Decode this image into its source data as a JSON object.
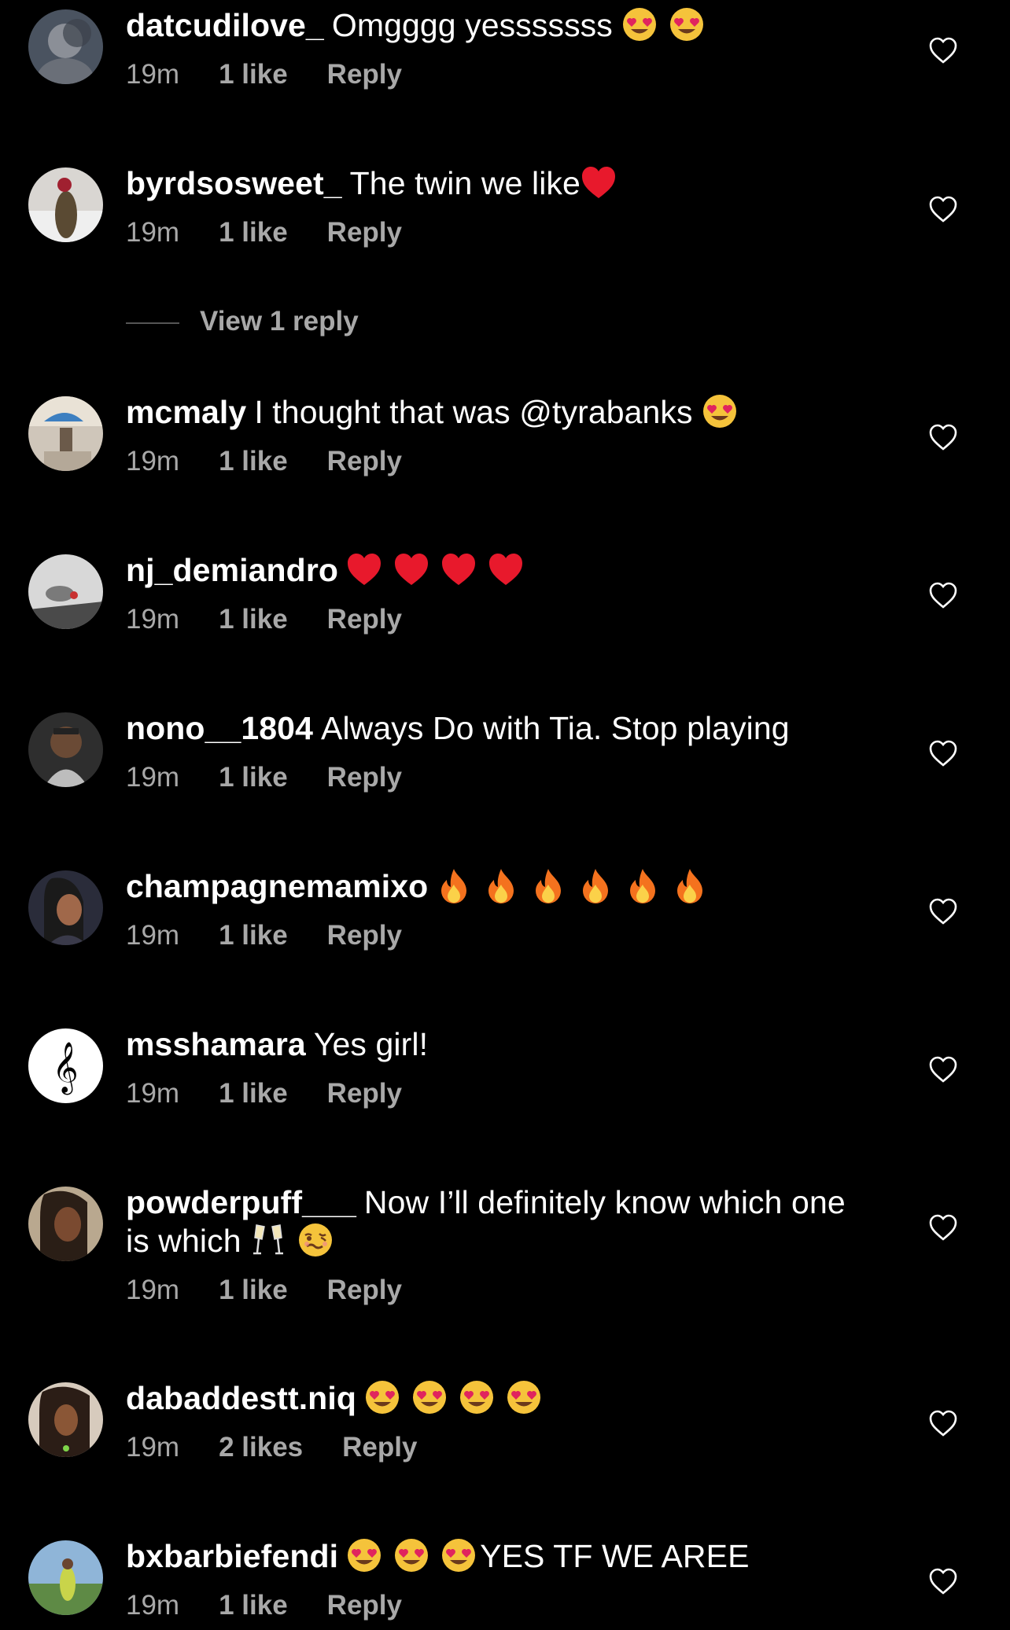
{
  "comments": [
    {
      "username": "datcudilove_",
      "text": "Omgggg yesssssss",
      "emojis": [
        "heart-eyes",
        "heart-eyes"
      ],
      "time": "19m",
      "likes": "1 like",
      "reply": "Reply"
    },
    {
      "username": "byrdsosweet_",
      "text": "The twin we like",
      "emojis": [
        "red-heart"
      ],
      "time": "19m",
      "likes": "1 like",
      "reply": "Reply",
      "view_replies": "View 1 reply"
    },
    {
      "username": "mcmaly",
      "text": "I thought that was @tyrabanks",
      "emojis": [
        "heart-eyes"
      ],
      "time": "19m",
      "likes": "1 like",
      "reply": "Reply"
    },
    {
      "username": "nj_demiandro",
      "text": "",
      "emojis": [
        "red-heart",
        "red-heart",
        "red-heart",
        "red-heart"
      ],
      "time": "19m",
      "likes": "1 like",
      "reply": "Reply"
    },
    {
      "username": "nono__1804",
      "text": "Always Do with Tia. Stop playing",
      "emojis": [],
      "time": "19m",
      "likes": "1 like",
      "reply": "Reply"
    },
    {
      "username": "champagnemamixo",
      "text": "",
      "emojis": [
        "fire",
        "fire",
        "fire",
        "fire",
        "fire",
        "fire"
      ],
      "time": "19m",
      "likes": "1 like",
      "reply": "Reply"
    },
    {
      "username": "msshamara",
      "text": "Yes girl!",
      "emojis": [],
      "time": "19m",
      "likes": "1 like",
      "reply": "Reply"
    },
    {
      "username": "powderpuff___",
      "text": "Now I’ll definitely know which one is which",
      "emojis": [
        "clinking-glasses",
        "woozy-face"
      ],
      "time": "19m",
      "likes": "1 like",
      "reply": "Reply"
    },
    {
      "username": "dabaddestt.niq",
      "text": "",
      "emojis": [
        "heart-eyes",
        "heart-eyes",
        "heart-eyes",
        "heart-eyes"
      ],
      "time": "19m",
      "likes": "2 likes",
      "reply": "Reply"
    },
    {
      "username": "bxbarbiefendi",
      "text": "YES TF WE AREE",
      "emojis_before_text": [
        "heart-eyes",
        "heart-eyes",
        "heart-eyes"
      ],
      "time": "19m",
      "likes": "1 like",
      "reply": "Reply"
    }
  ],
  "colors": {
    "background": "#000000",
    "text": "#ffffff",
    "meta": "#a8a8a8"
  },
  "icons": {
    "like": "heart-outline-icon",
    "view_replies": "line"
  }
}
